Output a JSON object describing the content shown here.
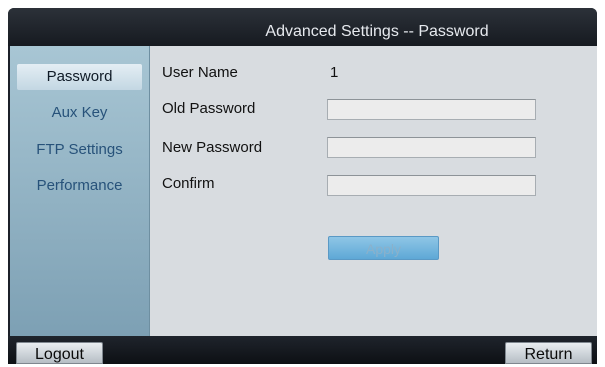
{
  "window": {
    "title": "Advanced Settings -- Password"
  },
  "sidebar": {
    "items": [
      {
        "label": "Password",
        "active": true
      },
      {
        "label": "Aux Key",
        "active": false
      },
      {
        "label": "FTP Settings",
        "active": false
      },
      {
        "label": "Performance",
        "active": false
      }
    ]
  },
  "form": {
    "user_name_label": "User Name",
    "user_name_value": "1",
    "old_password_label": "Old Password",
    "old_password_value": "",
    "new_password_label": "New Password",
    "new_password_value": "",
    "confirm_label": "Confirm",
    "confirm_value": "",
    "apply_label": "Apply"
  },
  "footer": {
    "logout_label": "Logout",
    "return_label": "Return"
  }
}
